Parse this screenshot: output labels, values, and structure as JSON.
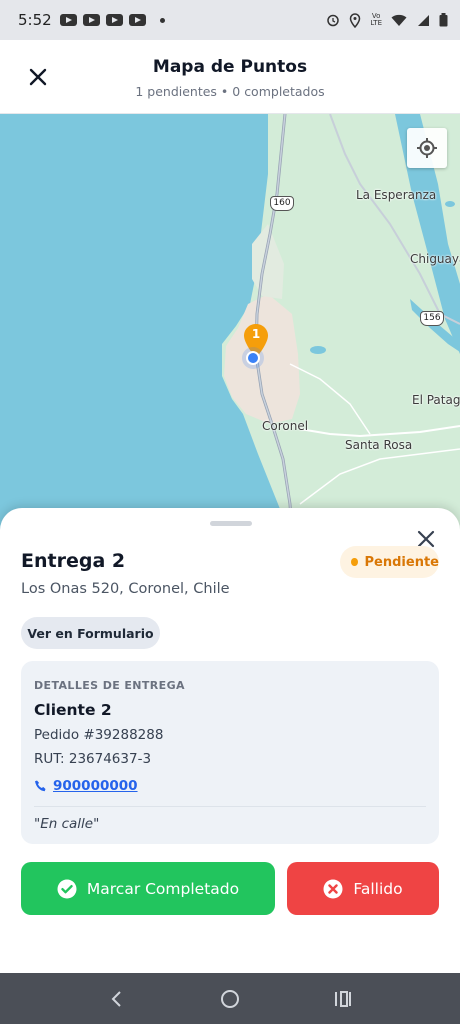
{
  "status_bar": {
    "time": "5:52",
    "network": "LTE"
  },
  "header": {
    "title": "Mapa de Puntos",
    "subtitle": "1 pendientes • 0 completados"
  },
  "map": {
    "labels": {
      "la_esperanza": "La Esperanza",
      "chiguaya": "Chiguaya",
      "el_patag": "El Patag",
      "coronel": "Coronel",
      "santa_rosa": "Santa Rosa"
    },
    "shields": {
      "r160": "160",
      "r156": "156"
    },
    "marker_number": "1",
    "colors": {
      "water": "#7cc7dd",
      "land": "#d3ecd8",
      "urban": "#ede4dc",
      "marker": "#f59e0b"
    }
  },
  "sheet": {
    "title": "Entrega 2",
    "status": "Pendiente",
    "address": "Los Onas 520, Coronel, Chile",
    "form_button": "Ver en Formulario",
    "details": {
      "label": "DETALLES DE ENTREGA",
      "client": "Cliente 2",
      "order": "Pedido #39288288",
      "rut": "RUT: 23674637-3",
      "phone": "900000000",
      "note": "\"En calle\""
    },
    "actions": {
      "complete": "Marcar Completado",
      "failed": "Fallido"
    },
    "colors": {
      "complete": "#22c55e",
      "failed": "#ef4444",
      "pending": "#f59e0b"
    }
  }
}
